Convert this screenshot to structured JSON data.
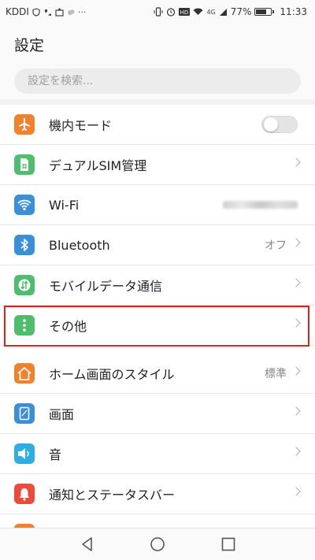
{
  "status_bar": {
    "carrier": "KDDI",
    "network": "4G",
    "battery_percent": "77%",
    "battery_level": 0.77,
    "time": "11:33"
  },
  "header": {
    "title": "設定"
  },
  "search": {
    "placeholder": "設定を検索..."
  },
  "settings_items": [
    {
      "label": "機内モード",
      "icon": "airplane-icon",
      "color": "#f0812d",
      "control": "toggle",
      "toggle_on": false
    },
    {
      "label": "デュアルSIM管理",
      "icon": "sim-card-icon",
      "color": "#4fbd6e",
      "control": "chevron"
    },
    {
      "label": "Wi-Fi",
      "icon": "wifi-icon",
      "color": "#3b8fd9",
      "control": "chevron",
      "value_obscured": true
    },
    {
      "label": "Bluetooth",
      "icon": "bluetooth-icon",
      "color": "#3b8fd9",
      "control": "chevron",
      "value": "オフ"
    },
    {
      "label": "モバイルデータ通信",
      "icon": "mobile-data-icon",
      "color": "#4fbd6e",
      "control": "chevron"
    },
    {
      "label": "その他",
      "icon": "more-vertical-icon",
      "color": "#4fbd6e",
      "control": "chevron",
      "highlighted": true
    },
    {
      "label": "ホーム画面のスタイル",
      "icon": "home-icon",
      "color": "#f0812d",
      "control": "chevron",
      "value": "標準"
    },
    {
      "label": "画面",
      "icon": "display-icon",
      "color": "#3b8fd9",
      "control": "chevron"
    },
    {
      "label": "音",
      "icon": "speaker-icon",
      "color": "#2eaede",
      "control": "chevron"
    },
    {
      "label": "通知とステータスバー",
      "icon": "bell-icon",
      "color": "#ea4b3c",
      "control": "chevron"
    }
  ],
  "highlight_color": "#e0201c",
  "nav": {
    "back": "back-icon",
    "home": "home-circle-icon",
    "recents": "recents-icon"
  }
}
